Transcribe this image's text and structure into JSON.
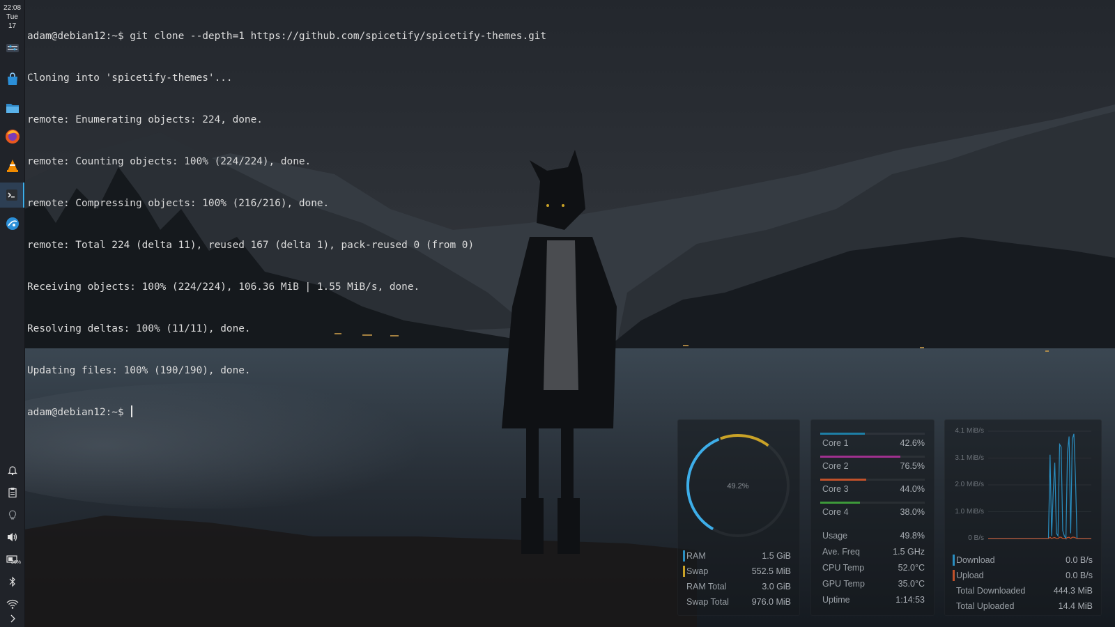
{
  "panel": {
    "clock": {
      "time": "22:08",
      "day": "Tue",
      "date": "17"
    },
    "launchers": [
      {
        "name": "system-settings",
        "icon": "settings-sliders-icon"
      },
      {
        "name": "discover",
        "icon": "store-bag-icon"
      },
      {
        "name": "dolphin",
        "icon": "folder-icon"
      },
      {
        "name": "firefox",
        "icon": "firefox-icon"
      },
      {
        "name": "vlc",
        "icon": "vlc-cone-icon"
      },
      {
        "name": "konsole",
        "icon": "terminal-icon",
        "active": true
      },
      {
        "name": "kde-connect",
        "icon": "globe-icon"
      }
    ],
    "tray": [
      {
        "name": "notifications",
        "icon": "bell-icon"
      },
      {
        "name": "clipboard",
        "icon": "clipboard-icon"
      },
      {
        "name": "night-light",
        "icon": "lightbulb-icon"
      },
      {
        "name": "volume",
        "icon": "speaker-icon"
      },
      {
        "name": "battery",
        "icon": "battery-icon",
        "badge": "36%"
      },
      {
        "name": "bluetooth",
        "icon": "bluetooth-icon"
      },
      {
        "name": "network",
        "icon": "wifi-icon"
      },
      {
        "name": "expand",
        "icon": "chevron-right-icon"
      },
      {
        "name": "peek",
        "icon": "desktop-peek-icon"
      }
    ]
  },
  "terminal": {
    "lines": [
      "adam@debian12:~$ git clone --depth=1 https://github.com/spicetify/spicetify-themes.git",
      "Cloning into 'spicetify-themes'...",
      "remote: Enumerating objects: 224, done.",
      "remote: Counting objects: 100% (224/224), done.",
      "remote: Compressing objects: 100% (216/216), done.",
      "remote: Total 224 (delta 11), reused 167 (delta 1), pack-reused 0 (from 0)",
      "Receiving objects: 100% (224/224), 106.36 MiB | 1.55 MiB/s, done.",
      "Resolving deltas: 100% (11/11), done.",
      "Updating files: 100% (190/190), done."
    ],
    "prompt": "adam@debian12:~$ "
  },
  "memory": {
    "gauge_label": "49.2%",
    "gauge_fraction": 0.492,
    "gauge_color_a": "#3daee9",
    "gauge_color_b": "#c9a227",
    "rows": [
      {
        "label": "RAM",
        "value": "1.5 GiB",
        "swatch": "#2a8fc2"
      },
      {
        "label": "Swap",
        "value": "552.5 MiB",
        "swatch": "#c9a227"
      },
      {
        "label": "RAM Total",
        "value": "3.0 GiB",
        "swatch": ""
      },
      {
        "label": "Swap Total",
        "value": "976.0 MiB",
        "swatch": ""
      }
    ]
  },
  "cpu": {
    "cores": [
      {
        "label": "Core 1",
        "value": "42.6%",
        "fraction": 0.426,
        "color": "#1e7fa6"
      },
      {
        "label": "Core 2",
        "value": "76.5%",
        "fraction": 0.765,
        "color": "#a0308f"
      },
      {
        "label": "Core 3",
        "value": "44.0%",
        "fraction": 0.44,
        "color": "#c2512a"
      },
      {
        "label": "Core 4",
        "value": "38.0%",
        "fraction": 0.38,
        "color": "#3e9a3a"
      }
    ],
    "stats": [
      {
        "label": "Usage",
        "value": "49.8%"
      },
      {
        "label": "Ave. Freq",
        "value": "1.5 GHz"
      },
      {
        "label": "CPU Temp",
        "value": "52.0°C"
      },
      {
        "label": "GPU Temp",
        "value": "35.0°C"
      },
      {
        "label": "Uptime",
        "value": "1:14:53"
      }
    ]
  },
  "network": {
    "chart_data": {
      "type": "line",
      "y_ticks": [
        "4.1 MiB/s",
        "3.1 MiB/s",
        "2.0 MiB/s",
        "1.0 MiB/s",
        "0 B/s"
      ],
      "ylim": [
        0,
        4.1
      ],
      "series": [
        {
          "name": "Download",
          "color": "#2a8fc2",
          "values": [
            0,
            0,
            0,
            0,
            0,
            0,
            0,
            0,
            0,
            0,
            0,
            0,
            0,
            0,
            0,
            0,
            0,
            0,
            0,
            0,
            0,
            0,
            0,
            0,
            0,
            0,
            0,
            0,
            0,
            0,
            0,
            0,
            0,
            0,
            0,
            0,
            0,
            0,
            0,
            3.2,
            0.1,
            1.8,
            2.9,
            0.2,
            0.1,
            3.6,
            3.5,
            0.3,
            0.1,
            0,
            3.3,
            3.9,
            0.2,
            3.8,
            4.0,
            2.4,
            0,
            0,
            0,
            0,
            0,
            0,
            0,
            0,
            0,
            0
          ]
        },
        {
          "name": "Upload",
          "color": "#c2512a",
          "values": [
            0,
            0,
            0,
            0,
            0,
            0,
            0,
            0,
            0,
            0,
            0,
            0,
            0,
            0,
            0,
            0,
            0,
            0,
            0,
            0,
            0,
            0,
            0,
            0,
            0,
            0,
            0,
            0,
            0,
            0,
            0,
            0,
            0,
            0,
            0,
            0,
            0,
            0,
            0,
            0.05,
            0,
            0.03,
            0.04,
            0,
            0,
            0.05,
            0.05,
            0,
            0,
            0,
            0.04,
            0.05,
            0,
            0.05,
            0.05,
            0.03,
            0,
            0,
            0,
            0,
            0,
            0,
            0,
            0,
            0,
            0
          ]
        }
      ]
    },
    "rows": [
      {
        "label": "Download",
        "value": "0.0 B/s",
        "swatch": "#2a8fc2"
      },
      {
        "label": "Upload",
        "value": "0.0 B/s",
        "swatch": "#c2512a"
      },
      {
        "label": "Total Downloaded",
        "value": "444.3 MiB",
        "swatch": ""
      },
      {
        "label": "Total Uploaded",
        "value": "14.4 MiB",
        "swatch": ""
      }
    ]
  }
}
